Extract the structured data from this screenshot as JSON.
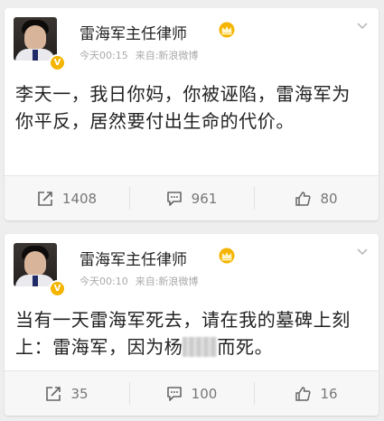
{
  "posts": [
    {
      "username": "雷海军主任律师",
      "time": "今天00:15",
      "source": "来自:新浪微博",
      "verified_badge": "V",
      "content": "李天一，我日你妈，你被诬陷，雷海军为你平反，居然要付出生命的代价。",
      "actions": {
        "repost_count": "1408",
        "comment_count": "961",
        "like_count": "80"
      }
    },
    {
      "username": "雷海军主任律师",
      "time": "今天00:10",
      "source": "来自:新浪微博",
      "verified_badge": "V",
      "content_before": "当有一天雷海军死去，请在我的墓碑上刻上：雷海军，因为杨",
      "content_after": "而死。",
      "actions": {
        "repost_count": "35",
        "comment_count": "100",
        "like_count": "16"
      }
    }
  ],
  "colors": {
    "accent_gold": "#f5b400",
    "text_primary": "#222222",
    "text_meta": "#aaaaaa",
    "icons": "#666666"
  },
  "icons": [
    "avatar",
    "verified-badge",
    "crown-icon",
    "chevron-down-icon",
    "repost-icon",
    "comment-icon",
    "like-icon"
  ]
}
